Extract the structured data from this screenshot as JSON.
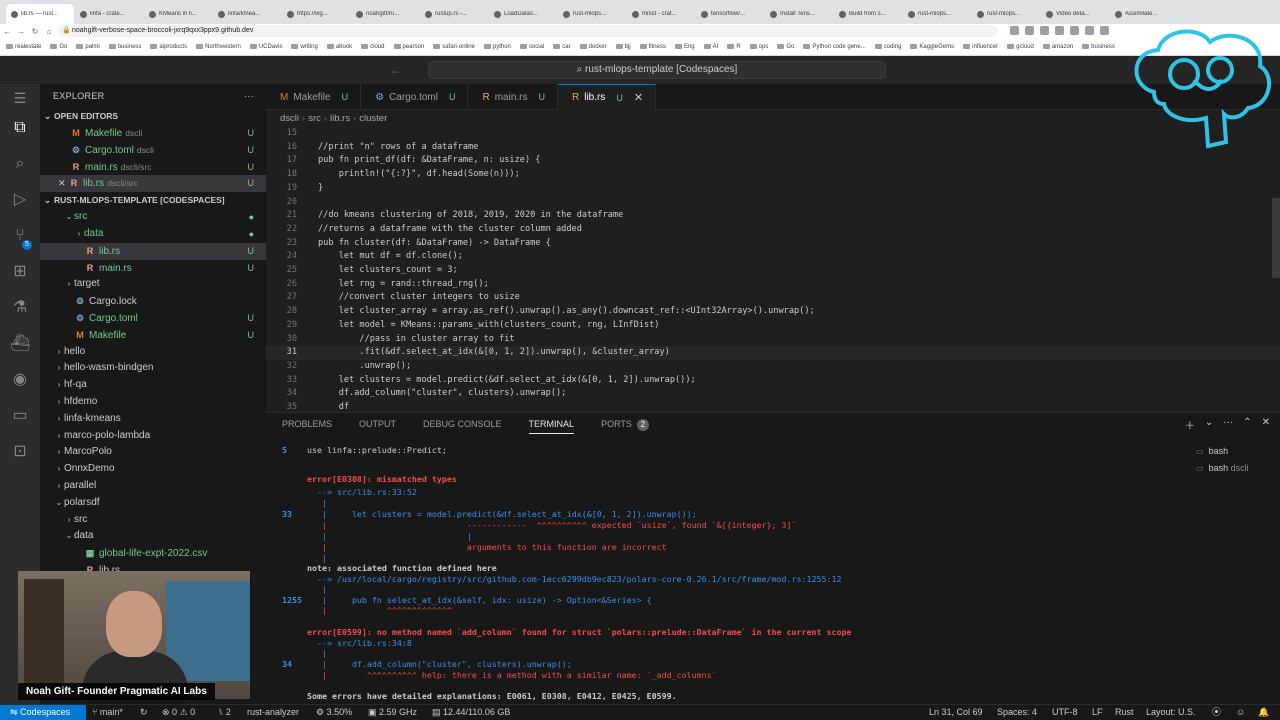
{
  "browser": {
    "tabs": [
      "lib.rs — rust...",
      "linfa - crate...",
      "KMeans in li...",
      "linfa/kmea...",
      "https://wg...",
      "noahgift/ru...",
      "rustup.rs -...",
      "LoadDatas...",
      "rust-mlops...",
      "mnist - crat...",
      "tensorflow/...",
      "Install Tens...",
      "Build from s...",
      "rust-mlops...",
      "rust-mlops...",
      "Video deta...",
      "Assimilate..."
    ],
    "url": "noahgift-verbose-space-broccoli-jxrq9qxx3ppx9.github.dev",
    "bookmarks": [
      "realestate",
      "Go",
      "palml",
      "business",
      "aiproducts",
      "Northwestern",
      "UCDavis",
      "writing",
      "abook",
      "cloud",
      "pearson",
      "safari-online",
      "python",
      "social",
      "car",
      "docker",
      "bjj",
      "fitness",
      "Eng",
      "AI",
      "R",
      "ops",
      "Go",
      "Python code gene...",
      "coding",
      "KaggleGems",
      "influencer",
      "gcloud",
      "amazon",
      "business"
    ]
  },
  "vscode": {
    "command_center": "rust-mlops-template [Codespaces]",
    "explorer": {
      "title": "EXPLORER",
      "open_editors_label": "OPEN EDITORS",
      "open_editors": [
        {
          "name": "Makefile",
          "sub": "dscli",
          "status": "U",
          "icon": "M"
        },
        {
          "name": "Cargo.toml",
          "sub": "dscli",
          "status": "U",
          "icon": "⚙"
        },
        {
          "name": "main.rs",
          "sub": "dscli/src",
          "status": "U",
          "icon": "R"
        },
        {
          "name": "lib.rs",
          "sub": "dscli/src",
          "status": "U",
          "icon": "R"
        }
      ],
      "workspace_label": "RUST-MLOPS-TEMPLATE [CODESPACES]",
      "tree": [
        {
          "name": "src",
          "chev": "⌄",
          "indent": 1,
          "status": "●"
        },
        {
          "name": "data",
          "chev": "›",
          "indent": 2,
          "status": "●"
        },
        {
          "name": "lib.rs",
          "chev": "",
          "indent": 2,
          "status": "U",
          "icon": "R"
        },
        {
          "name": "main.rs",
          "chev": "",
          "indent": 2,
          "status": "U",
          "icon": "R"
        },
        {
          "name": "target",
          "chev": "›",
          "indent": 1,
          "status": ""
        },
        {
          "name": "Cargo.lock",
          "chev": "",
          "indent": 1,
          "status": "",
          "icon": "⚙"
        },
        {
          "name": "Cargo.toml",
          "chev": "",
          "indent": 1,
          "status": "U",
          "icon": "⚙"
        },
        {
          "name": "Makefile",
          "chev": "",
          "indent": 1,
          "status": "U",
          "icon": "M"
        },
        {
          "name": "hello",
          "chev": "›",
          "indent": 0,
          "status": ""
        },
        {
          "name": "hello-wasm-bindgen",
          "chev": "›",
          "indent": 0,
          "status": ""
        },
        {
          "name": "hf-qa",
          "chev": "›",
          "indent": 0,
          "status": ""
        },
        {
          "name": "hfdemo",
          "chev": "›",
          "indent": 0,
          "status": ""
        },
        {
          "name": "linfa-kmeans",
          "chev": "›",
          "indent": 0,
          "status": ""
        },
        {
          "name": "marco-polo-lambda",
          "chev": "›",
          "indent": 0,
          "status": ""
        },
        {
          "name": "MarcoPolo",
          "chev": "›",
          "indent": 0,
          "status": ""
        },
        {
          "name": "OnnxDemo",
          "chev": "›",
          "indent": 0,
          "status": ""
        },
        {
          "name": "parallel",
          "chev": "›",
          "indent": 0,
          "status": ""
        },
        {
          "name": "polarsdf",
          "chev": "⌄",
          "indent": 0,
          "status": ""
        },
        {
          "name": "src",
          "chev": "›",
          "indent": 1,
          "status": ""
        },
        {
          "name": "data",
          "chev": "⌄",
          "indent": 1,
          "status": ""
        },
        {
          "name": "global-life-expt-2022.csv",
          "chev": "",
          "indent": 2,
          "status": "",
          "icon": "▦"
        },
        {
          "name": "lib.rs",
          "chev": "",
          "indent": 2,
          "status": "",
          "icon": "R"
        }
      ]
    },
    "tabs": [
      {
        "name": "Makefile",
        "status": "U",
        "icon": "M"
      },
      {
        "name": "Cargo.toml",
        "status": "U",
        "icon": "⚙"
      },
      {
        "name": "main.rs",
        "status": "U",
        "icon": "R"
      },
      {
        "name": "lib.rs",
        "status": "U",
        "icon": "R",
        "active": true
      }
    ],
    "breadcrumb": [
      "dscli",
      "src",
      "lib.rs",
      "cluster"
    ],
    "code_lines": [
      {
        "n": "15",
        "t": ""
      },
      {
        "n": "16",
        "t": "//print \"n\" rows of a dataframe"
      },
      {
        "n": "17",
        "t": "pub fn print_df(df: &DataFrame, n: usize) {"
      },
      {
        "n": "18",
        "t": "    println!(\"{:?}\", df.head(Some(n)));"
      },
      {
        "n": "19",
        "t": "}"
      },
      {
        "n": "20",
        "t": ""
      },
      {
        "n": "21",
        "t": "//do kmeans clustering of 2018, 2019, 2020 in the dataframe"
      },
      {
        "n": "22",
        "t": "//returns a dataframe with the cluster column added"
      },
      {
        "n": "23",
        "t": "pub fn cluster(df: &DataFrame) -> DataFrame {"
      },
      {
        "n": "24",
        "t": "    let mut df = df.clone();"
      },
      {
        "n": "25",
        "t": "    let clusters_count = 3;"
      },
      {
        "n": "26",
        "t": "    let rng = rand::thread_rng();"
      },
      {
        "n": "27",
        "t": "    //convert cluster integers to usize"
      },
      {
        "n": "28",
        "t": "    let cluster_array = array.as_ref().unwrap().as_any().downcast_ref::<UInt32Array>().unwrap();"
      },
      {
        "n": "29",
        "t": "    let model = KMeans::params_with(clusters_count, rng, LInfDist)"
      },
      {
        "n": "30",
        "t": "        //pass in cluster array to fit"
      },
      {
        "n": "31",
        "t": "        .fit(&df.select_at_idx(&[0, 1, 2]).unwrap(), &cluster_array)"
      },
      {
        "n": "32",
        "t": "        .unwrap();"
      },
      {
        "n": "33",
        "t": "    let clusters = model.predict(&df.select_at_idx(&[0, 1, 2]).unwrap());"
      },
      {
        "n": "34",
        "t": "    df.add_column(\"cluster\", clusters).unwrap();"
      },
      {
        "n": "35",
        "t": "    df"
      }
    ],
    "panel": {
      "tabs": [
        "PROBLEMS",
        "OUTPUT",
        "DEBUG CONSOLE",
        "TERMINAL",
        "PORTS"
      ],
      "ports_badge": "2",
      "terminals": [
        "bash",
        "bash"
      ],
      "terminal_sub": "dscli",
      "lines": [
        {
          "g": "5",
          "t": "use linfa::prelude::Predict;"
        },
        {
          "g": "",
          "t": ""
        },
        {
          "g": "",
          "t": "error[E0308]: mismatched types",
          "kind": "error"
        },
        {
          "g": "",
          "t": "  --> src/lib.rs:33:52"
        },
        {
          "g": "",
          "t": "   |"
        },
        {
          "g": "33",
          "t": "   |     let clusters = model.predict(&df.select_at_idx(&[0, 1, 2]).unwrap());"
        },
        {
          "g": "",
          "t": "   |                            ------------  ^^^^^^^^^^ expected `usize`, found `&[{integer}; 3]`"
        },
        {
          "g": "",
          "t": "   |                            |"
        },
        {
          "g": "",
          "t": "   |                            arguments to this function are incorrect"
        },
        {
          "g": "",
          "t": "   |"
        },
        {
          "g": "",
          "t": "note: associated function defined here",
          "kind": "note"
        },
        {
          "g": "",
          "t": "  --> /usr/local/cargo/registry/src/github.com-1ecc6299db9ec823/polars-core-0.26.1/src/frame/mod.rs:1255:12"
        },
        {
          "g": "",
          "t": "   |"
        },
        {
          "g": "1255",
          "t": "   |     pub fn select_at_idx(&self, idx: usize) -> Option<&Series> {"
        },
        {
          "g": "",
          "t": "   |            ^^^^^^^^^^^^^"
        },
        {
          "g": "",
          "t": ""
        },
        {
          "g": "",
          "t": "error[E0599]: no method named `add_column` found for struct `polars::prelude::DataFrame` in the current scope",
          "kind": "error"
        },
        {
          "g": "",
          "t": "  --> src/lib.rs:34:8"
        },
        {
          "g": "",
          "t": "   |"
        },
        {
          "g": "34",
          "t": "   |     df.add_column(\"cluster\", clusters).unwrap();"
        },
        {
          "g": "",
          "t": "   |        ^^^^^^^^^^ help: there is a method with a similar name: `_add_columns`"
        },
        {
          "g": "",
          "t": ""
        },
        {
          "g": "",
          "t": "Some errors have detailed explanations: E0061, E0308, E0412, E0425, E0599.",
          "kind": "bold"
        }
      ]
    },
    "status": {
      "remote": "Codespaces",
      "branch": "main*",
      "problems_errors": "0",
      "problems_warnings": "0",
      "ports": "2",
      "rust_analyzer": "rust-analyzer",
      "cpu": "3.50%",
      "ghz": "2.59 GHz",
      "mem": "12.44/110.06 GB",
      "cursor": "Ln 31, Col 69",
      "spaces": "Spaces: 4",
      "encoding": "UTF-8",
      "eol": "LF",
      "language": "Rust",
      "layout": "Layout: U.S."
    }
  },
  "overlay": {
    "caption": "Noah Gift- Founder Pragmatic AI Labs"
  },
  "colors": {
    "accent": "#0078d4",
    "error_red": "#f14c4c",
    "untracked_green": "#73c991",
    "logo_cyan": "#2ec4e6"
  }
}
